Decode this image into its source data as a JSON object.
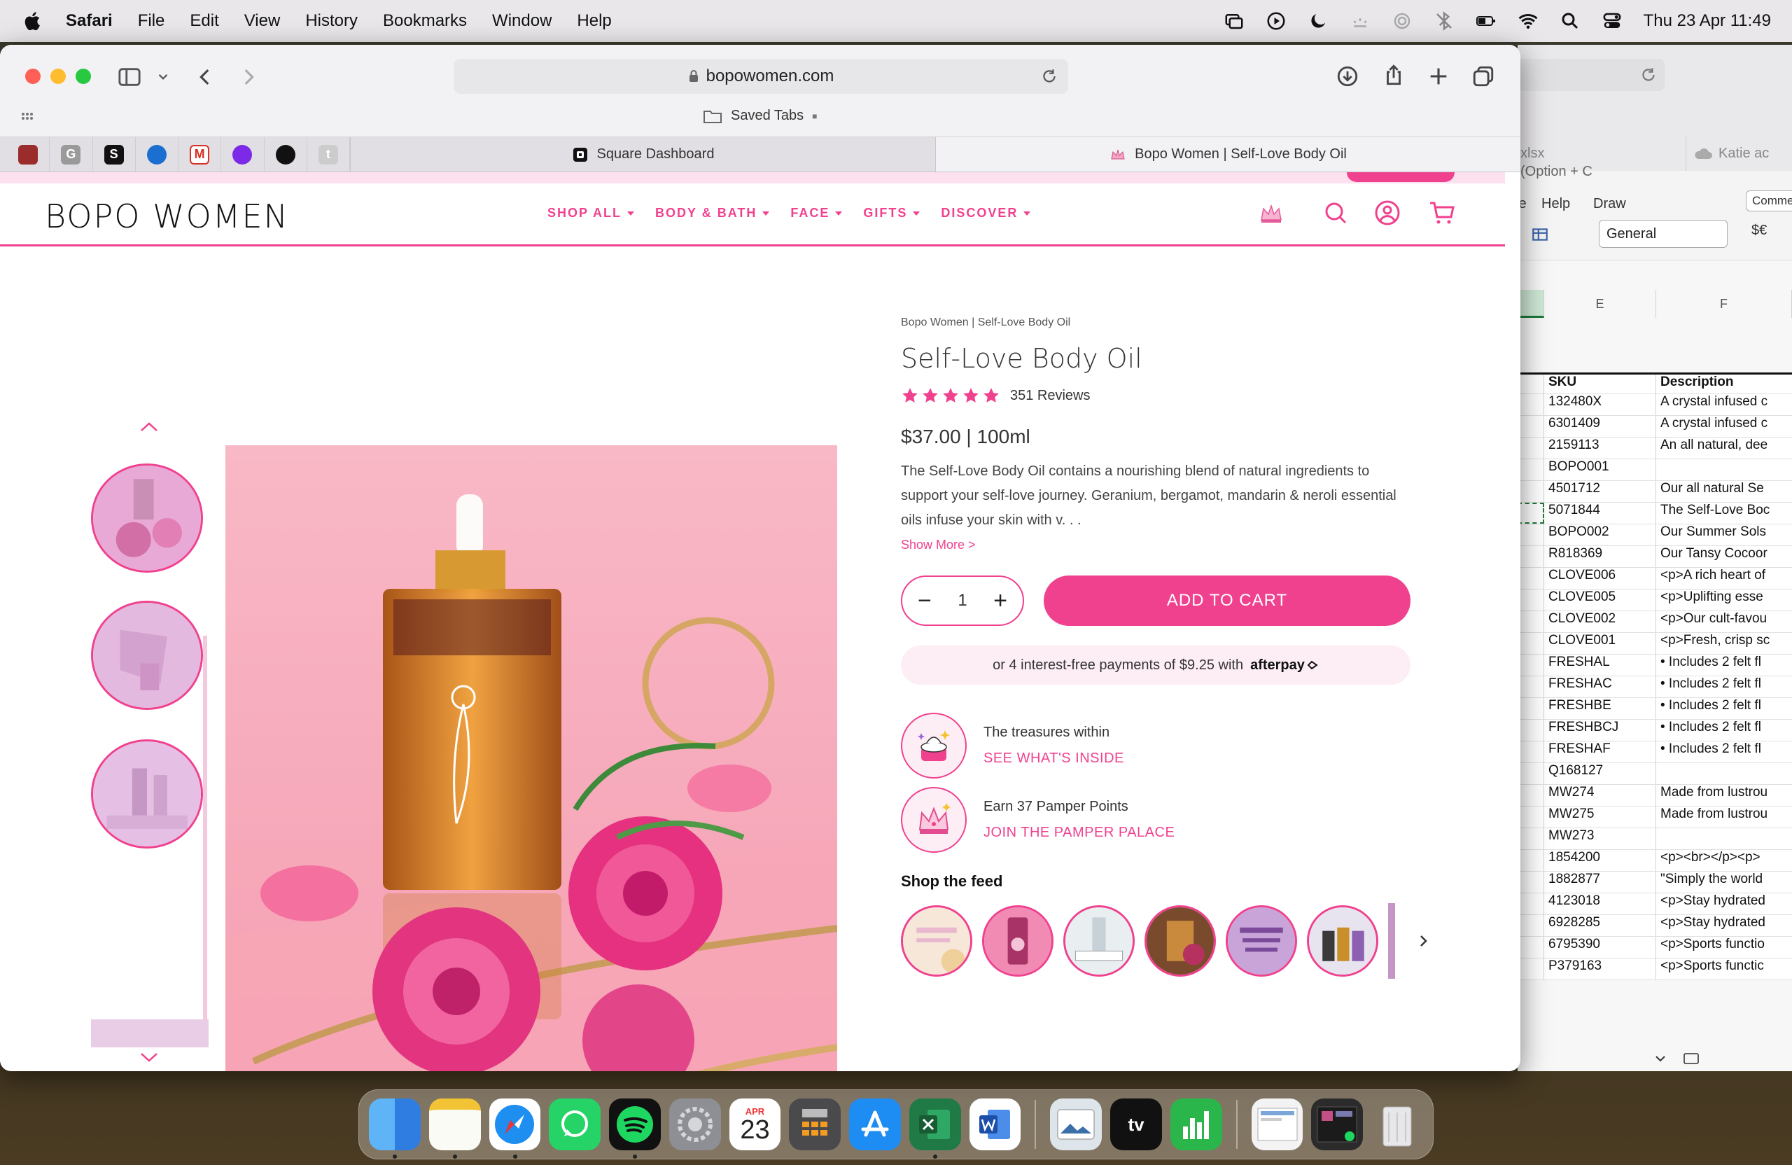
{
  "menubar": {
    "app_name": "Safari",
    "menus": [
      "File",
      "Edit",
      "View",
      "History",
      "Bookmarks",
      "Window",
      "Help"
    ],
    "clock": "Thu 23 Apr  11:49"
  },
  "browser": {
    "url": "bopowomen.com",
    "saved_tabs": "Saved Tabs",
    "pinned_tabs": [
      "G",
      "S",
      "M",
      "t"
    ],
    "tabs": [
      {
        "title": "Square Dashboard",
        "active": false
      },
      {
        "title": "Bopo Women | Self-Love Body Oil",
        "active": true
      }
    ]
  },
  "site": {
    "logo": "BOPO WOMEN",
    "nav": [
      "SHOP ALL",
      "BODY & BATH",
      "FACE",
      "GIFTS",
      "DISCOVER"
    ],
    "accent_color": "#f0418f"
  },
  "product": {
    "breadcrumb": "Bopo Women | Self-Love Body Oil",
    "title": "Self-Love Body Oil",
    "rating": 5,
    "reviews": "351 Reviews",
    "price": "$37.00  |  100ml",
    "description": "The Self-Love Body Oil contains a nourishing blend of natural ingredients to support your self-love journey. Geranium, bergamot, mandarin & neroli essential oils infuse your skin with v. . .",
    "show_more": "Show More >",
    "quantity": "1",
    "add_to_cart": "ADD TO CART",
    "afterpay_text": "or 4 interest-free payments of $9.25 with",
    "afterpay_brand": "afterpay",
    "perks": [
      {
        "line1": "The treasures within",
        "line2": "SEE WHAT'S INSIDE"
      },
      {
        "line1": "Earn 37 Pamper Points",
        "line2": "JOIN THE PAMPER PALACE"
      }
    ],
    "feed_title": "Shop the feed"
  },
  "excel": {
    "address_fragment": "(Option + C",
    "sheet_tabs": [
      "xlsx",
      "Katie ac"
    ],
    "ribbon": [
      "te",
      "Help",
      "Draw"
    ],
    "comments": "Comments",
    "format": "General",
    "currency": "$€",
    "columns": [
      "E",
      "F"
    ],
    "header": {
      "sku": "SKU",
      "description": "Description"
    },
    "rows": [
      {
        "sku": "132480X",
        "desc": "A crystal infused c"
      },
      {
        "sku": "6301409",
        "desc": "A crystal infused c"
      },
      {
        "sku": "2159113",
        "desc": "An all natural, dee"
      },
      {
        "sku": "BOPO001",
        "desc": ""
      },
      {
        "sku": "4501712",
        "desc": "Our all natural Se"
      },
      {
        "sku": "5071844",
        "desc": "The Self-Love Boc"
      },
      {
        "sku": "BOPO002",
        "desc": "Our Summer Sols"
      },
      {
        "sku": "R818369",
        "desc": "Our Tansy Cocoor"
      },
      {
        "sku": "CLOVE006",
        "desc": "<p>A rich heart of"
      },
      {
        "sku": "CLOVE005",
        "desc": "<p>Uplifting esse"
      },
      {
        "sku": "CLOVE002",
        "desc": "<p>Our cult-favou"
      },
      {
        "sku": "CLOVE001",
        "desc": "<p>Fresh, crisp sc"
      },
      {
        "sku": "FRESHAL",
        "desc": "• Includes 2 felt fl"
      },
      {
        "sku": "FRESHAC",
        "desc": "• Includes 2 felt fl"
      },
      {
        "sku": "FRESHBE",
        "desc": "• Includes 2 felt fl"
      },
      {
        "sku": "FRESHBCJ",
        "desc": "• Includes 2 felt fl"
      },
      {
        "sku": "FRESHAF",
        "desc": "• Includes 2 felt fl"
      },
      {
        "sku": "Q168127",
        "desc": ""
      },
      {
        "sku": "MW274",
        "desc": "Made from lustrou"
      },
      {
        "sku": "MW275",
        "desc": "Made from lustrou"
      },
      {
        "sku": "MW273",
        "desc": ""
      },
      {
        "sku": "1854200",
        "desc": "<p><br></p><p>"
      },
      {
        "sku": "1882877",
        "desc": "\"Simply the world"
      },
      {
        "sku": "4123018",
        "desc": "<p>Stay hydrated"
      },
      {
        "sku": "6928285",
        "desc": "<p>Stay hydrated"
      },
      {
        "sku": "6795390",
        "desc": "<p>Sports functio"
      },
      {
        "sku": "P379163",
        "desc": "<p>Sports functic"
      }
    ]
  },
  "dock": {
    "calendar_month": "APR",
    "calendar_day": "23",
    "tv_label": "tv"
  }
}
